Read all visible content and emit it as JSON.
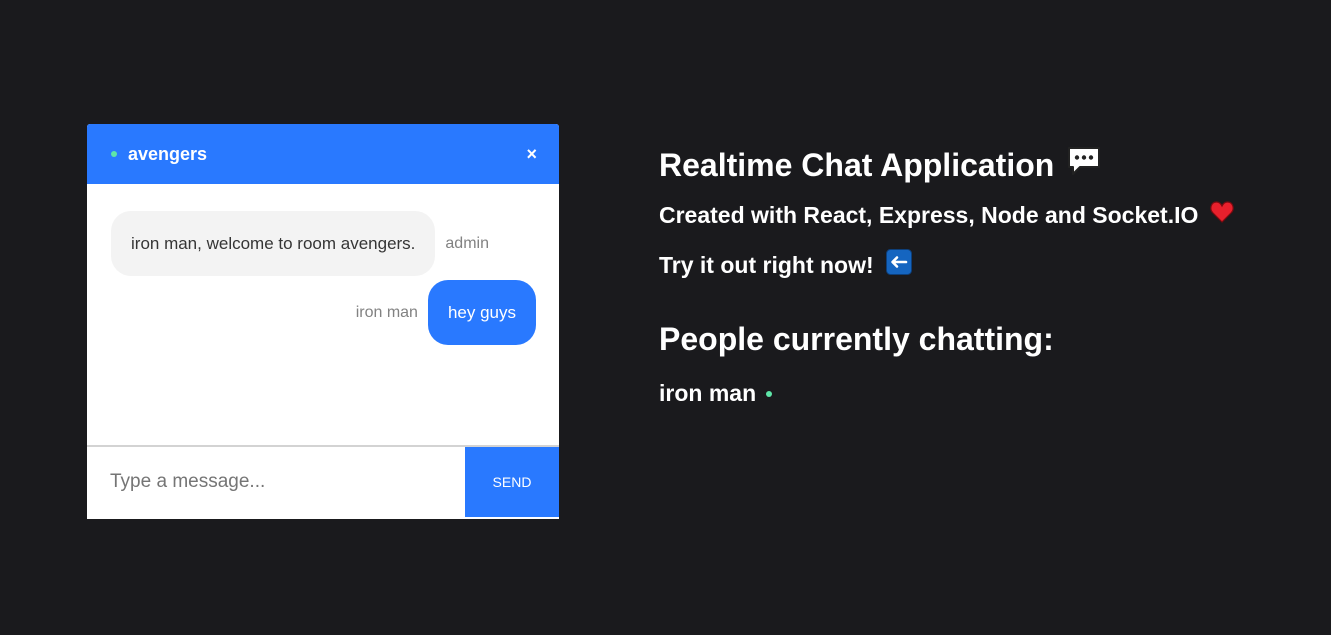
{
  "chat": {
    "room_name": "avengers",
    "close_symbol": "×",
    "messages": [
      {
        "text": "iron man, welcome to room avengers.",
        "sender": "admin",
        "side": "left"
      },
      {
        "text": "hey guys",
        "sender": "iron man",
        "side": "right"
      }
    ],
    "input": {
      "placeholder": "Type a message...",
      "value": ""
    },
    "send_label": "Send"
  },
  "info": {
    "title": "Realtime Chat Application",
    "subtitle": "Created with React, Express, Node and Socket.IO",
    "cta": "Try it out right now!",
    "people_title": "People currently chatting:",
    "people": [
      "iron man"
    ]
  },
  "colors": {
    "accent": "#2979ff",
    "background": "#1a1a1d",
    "online": "#5ee6a8"
  },
  "icons": {
    "title_icon": "speech-balloon-icon",
    "subtitle_icon": "heart-icon",
    "cta_icon": "left-arrow-icon",
    "online_icon": "online-dot-icon"
  }
}
